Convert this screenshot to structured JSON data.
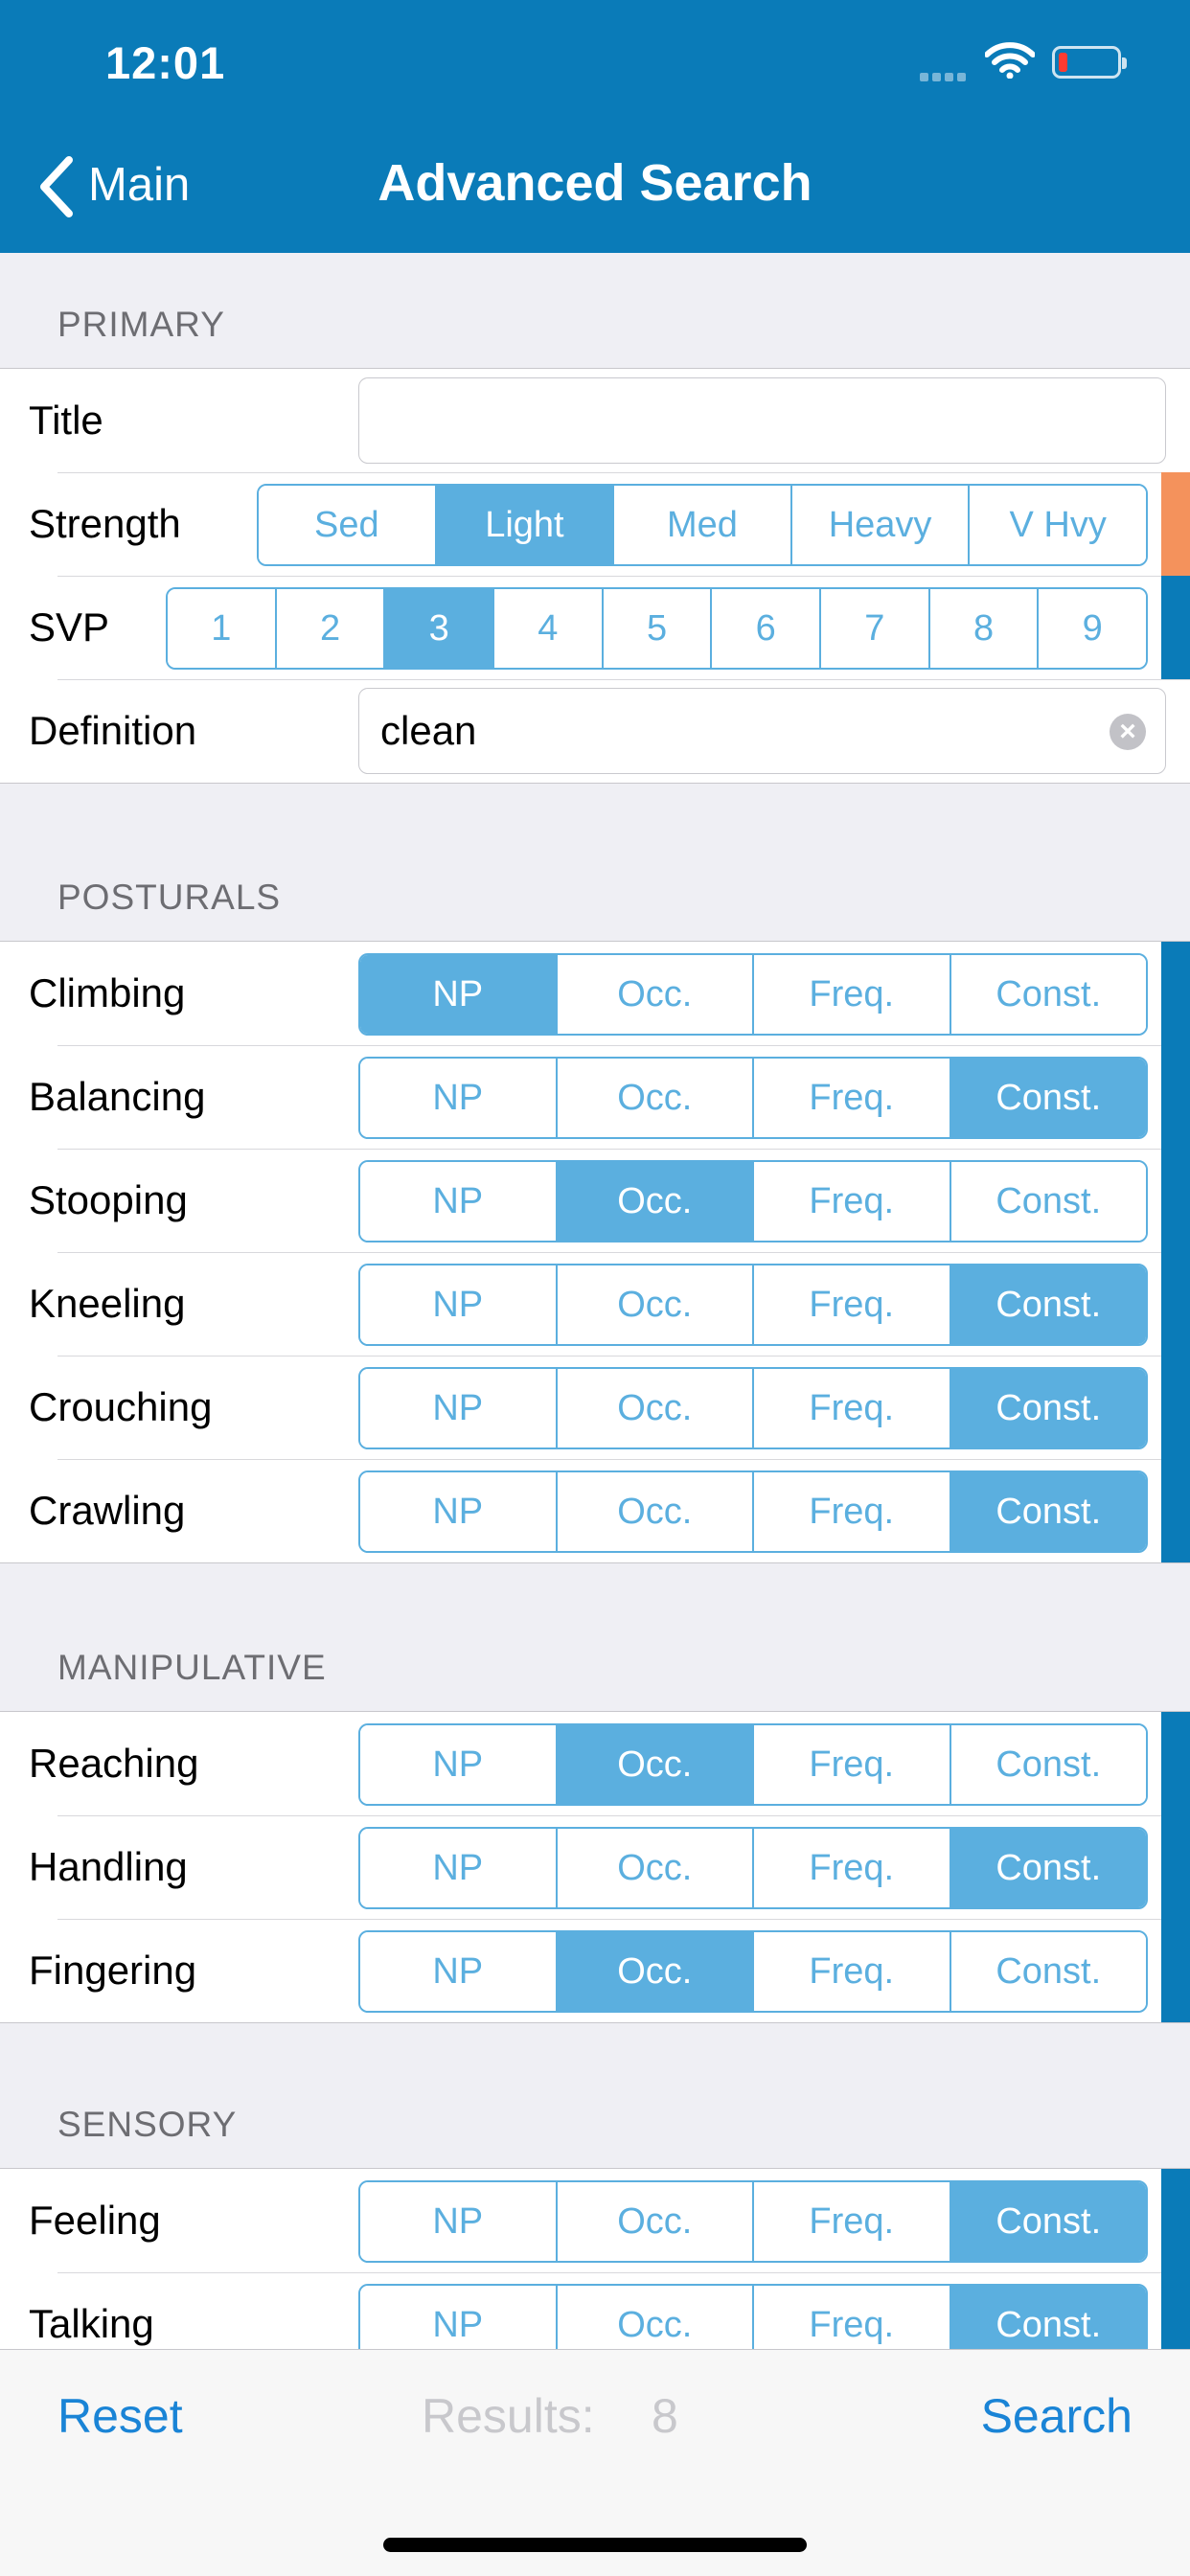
{
  "status": {
    "time": "12:01"
  },
  "nav": {
    "back_label": "Main",
    "title": "Advanced Search"
  },
  "primary": {
    "header": "PRIMARY",
    "title_label": "Title",
    "title_value": "",
    "strength_label": "Strength",
    "strength_options": [
      "Sed",
      "Light",
      "Med",
      "Heavy",
      "V Hvy"
    ],
    "strength_selected": "Light",
    "svp_label": "SVP",
    "svp_options": [
      "1",
      "2",
      "3",
      "4",
      "5",
      "6",
      "7",
      "8",
      "9"
    ],
    "svp_selected": "3",
    "definition_label": "Definition",
    "definition_value": "clean"
  },
  "frequency_options": [
    "NP",
    "Occ.",
    "Freq.",
    "Const."
  ],
  "posturals": {
    "header": "POSTURALS",
    "rows": [
      {
        "label": "Climbing",
        "selected": "NP"
      },
      {
        "label": "Balancing",
        "selected": "Const."
      },
      {
        "label": "Stooping",
        "selected": "Occ."
      },
      {
        "label": "Kneeling",
        "selected": "Const."
      },
      {
        "label": "Crouching",
        "selected": "Const."
      },
      {
        "label": "Crawling",
        "selected": "Const."
      }
    ]
  },
  "manipulative": {
    "header": "MANIPULATIVE",
    "rows": [
      {
        "label": "Reaching",
        "selected": "Occ."
      },
      {
        "label": "Handling",
        "selected": "Const."
      },
      {
        "label": "Fingering",
        "selected": "Occ."
      }
    ]
  },
  "sensory": {
    "header": "SENSORY",
    "rows": [
      {
        "label": "Feeling",
        "selected": "Const."
      },
      {
        "label": "Talking",
        "selected": "Const."
      }
    ]
  },
  "toolbar": {
    "reset_label": "Reset",
    "results_label": "Results:",
    "results_value": "8",
    "search_label": "Search"
  },
  "colors": {
    "nav_bar": "#0a7bb8",
    "segment_tint": "#5bafdf",
    "strength_accent": "#f4925c",
    "toolbar_action": "#1a84d6"
  }
}
